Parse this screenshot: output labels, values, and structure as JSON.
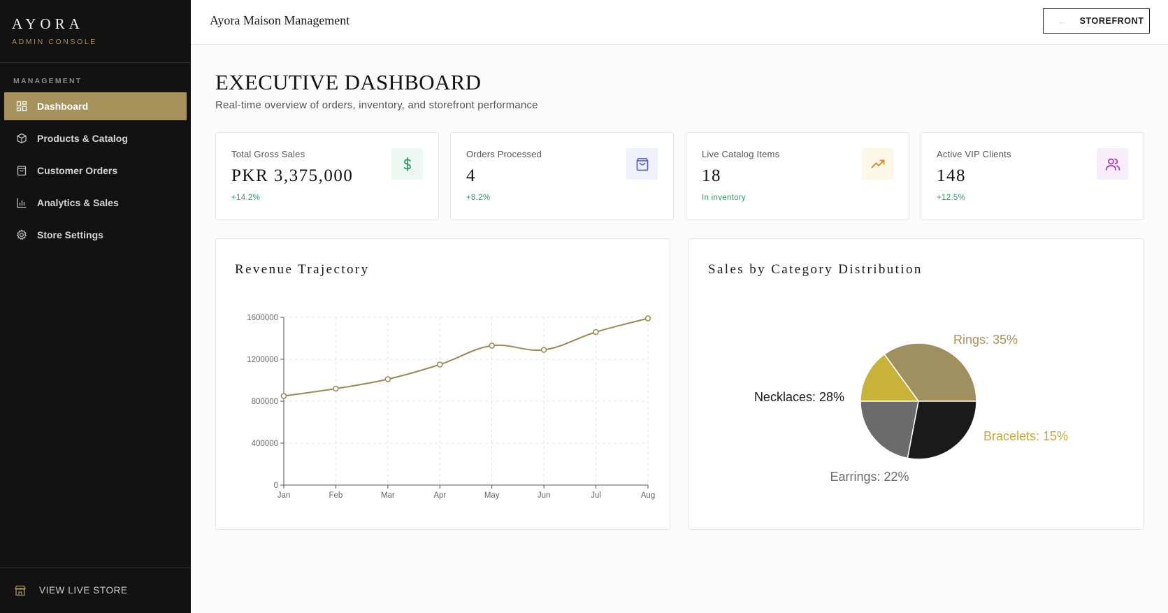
{
  "sidebar": {
    "brand": "AYORA",
    "brand_sub": "ADMIN CONSOLE",
    "section_heading": "MANAGEMENT",
    "items": [
      {
        "label": "Dashboard",
        "icon": "grid-icon"
      },
      {
        "label": "Products & Catalog",
        "icon": "box-icon"
      },
      {
        "label": "Customer Orders",
        "icon": "bag-icon"
      },
      {
        "label": "Analytics & Sales",
        "icon": "bar-chart-icon"
      },
      {
        "label": "Store Settings",
        "icon": "gear-icon"
      }
    ],
    "active_index": 0,
    "footer_label": "VIEW LIVE STORE",
    "footer_icon": "store-icon"
  },
  "topbar": {
    "title": "Ayora Maison Management",
    "storefront_label": "STOREFRONT",
    "storefront_icon": "arrow-left-icon"
  },
  "page": {
    "title": "EXECUTIVE DASHBOARD",
    "subtitle": "Real-time overview of orders, inventory, and storefront performance"
  },
  "stats": [
    {
      "label": "Total Gross Sales",
      "value": "PKR 3,375,000",
      "delta": "+14.2%",
      "icon": "dollar-icon",
      "icon_color": "#2e9b63",
      "icon_bg": "#eef8f2"
    },
    {
      "label": "Orders Processed",
      "value": "4",
      "delta": "+8.2%",
      "icon": "shopping-bag-icon",
      "icon_color": "#5b5fc7",
      "icon_bg": "#eef0fb"
    },
    {
      "label": "Live Catalog Items",
      "value": "18",
      "delta": "In inventory",
      "icon": "trending-up-icon",
      "icon_color": "#d08a1e",
      "icon_bg": "#fdf7e8"
    },
    {
      "label": "Active VIP Clients",
      "value": "148",
      "delta": "+12.5%",
      "icon": "users-icon",
      "icon_color": "#a535c9",
      "icon_bg": "#f8eefb"
    }
  ],
  "colors": {
    "accent": "#a8925c",
    "line": "#9a8a56",
    "sidebar_bg": "#121212"
  },
  "chart_data": [
    {
      "type": "line",
      "title": "Revenue Trajectory",
      "x": [
        "Jan",
        "Feb",
        "Mar",
        "Apr",
        "May",
        "Jun",
        "Jul",
        "Aug"
      ],
      "series": [
        {
          "values": [
            850000,
            920000,
            1010000,
            1150000,
            1330000,
            1290000,
            1460000,
            1590000
          ]
        }
      ],
      "ylim": [
        0,
        1600000
      ],
      "yticks": [
        0,
        400000,
        800000,
        1200000,
        1600000
      ],
      "grid": true,
      "smooth": true
    },
    {
      "type": "pie",
      "title": "Sales by Category Distribution",
      "slices": [
        {
          "label": "Rings",
          "value": 35,
          "color": "#a08f5f",
          "label_color": "#a8925c",
          "text": "Rings: 35%"
        },
        {
          "label": "Bracelets",
          "value": 15,
          "color": "#c9b23a",
          "label_color": "#c2a93a",
          "text": "Bracelets: 15%"
        },
        {
          "label": "Earrings",
          "value": 22,
          "color": "#6b6b6b",
          "label_color": "#6b6b6b",
          "text": "Earrings: 22%"
        },
        {
          "label": "Necklaces",
          "value": 28,
          "color": "#1a1a1a",
          "label_color": "#1a1a1a",
          "text": "Necklaces: 28%"
        }
      ]
    }
  ]
}
